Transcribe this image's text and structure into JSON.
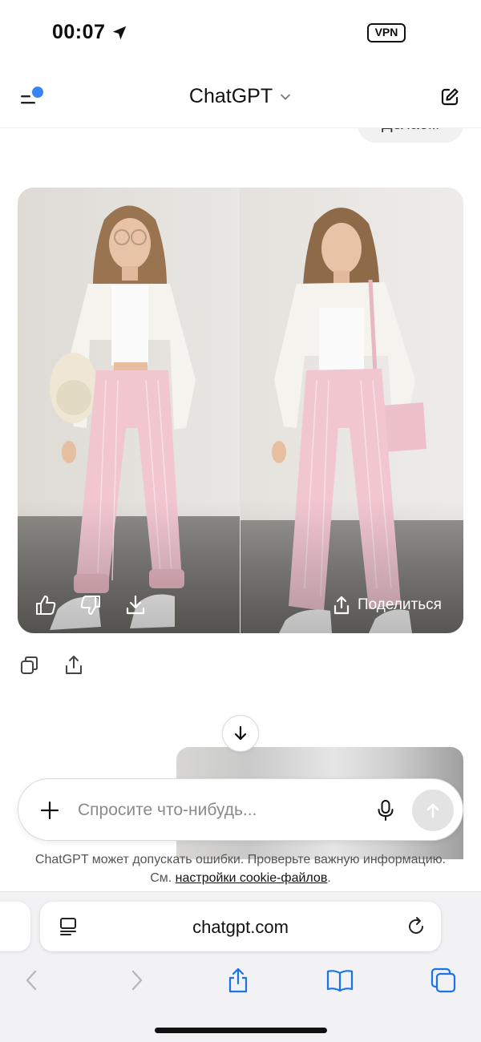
{
  "status_bar": {
    "time": "00:07",
    "vpn_label": "VPN",
    "location_icon": "location-arrow-icon"
  },
  "header": {
    "title": "ChatGPT",
    "menu_icon": "sidebar-menu-icon",
    "title_icon": "chevron-down-icon",
    "new_chat_icon": "new-chat-edit-icon",
    "notification_dot_color": "#3a83f6"
  },
  "chat": {
    "previous_message": "Делаем",
    "image_actions": {
      "like_icon": "thumbs-up-icon",
      "dislike_icon": "thumbs-down-icon",
      "download_icon": "download-icon",
      "share_icon": "share-icon",
      "share_label": "Поделиться"
    },
    "message_actions": {
      "copy_icon": "copy-icon",
      "share_icon": "share-icon"
    },
    "scroll_down_icon": "arrow-down-icon"
  },
  "composer": {
    "placeholder": "Спросите что-нибудь...",
    "plus_icon": "plus-icon",
    "mic_icon": "microphone-icon",
    "send_icon": "arrow-up-icon"
  },
  "disclaimer": {
    "line1": "ChatGPT может допускать ошибки. Проверьте важную информацию.",
    "line2_prefix": "См.",
    "link": "настройки cookie-файлов",
    "line2_suffix": "."
  },
  "browser": {
    "url": "chatgpt.com",
    "reader_icon": "reader-mode-icon",
    "reload_icon": "reload-icon",
    "toolbar": [
      "back-icon",
      "forward-icon",
      "share-icon",
      "bookmarks-icon",
      "tabs-icon"
    ]
  },
  "colors": {
    "accent_blue": "#3a83f6",
    "safari_blue": "#1a73e8",
    "pants_pink": "#f1c6cf"
  }
}
